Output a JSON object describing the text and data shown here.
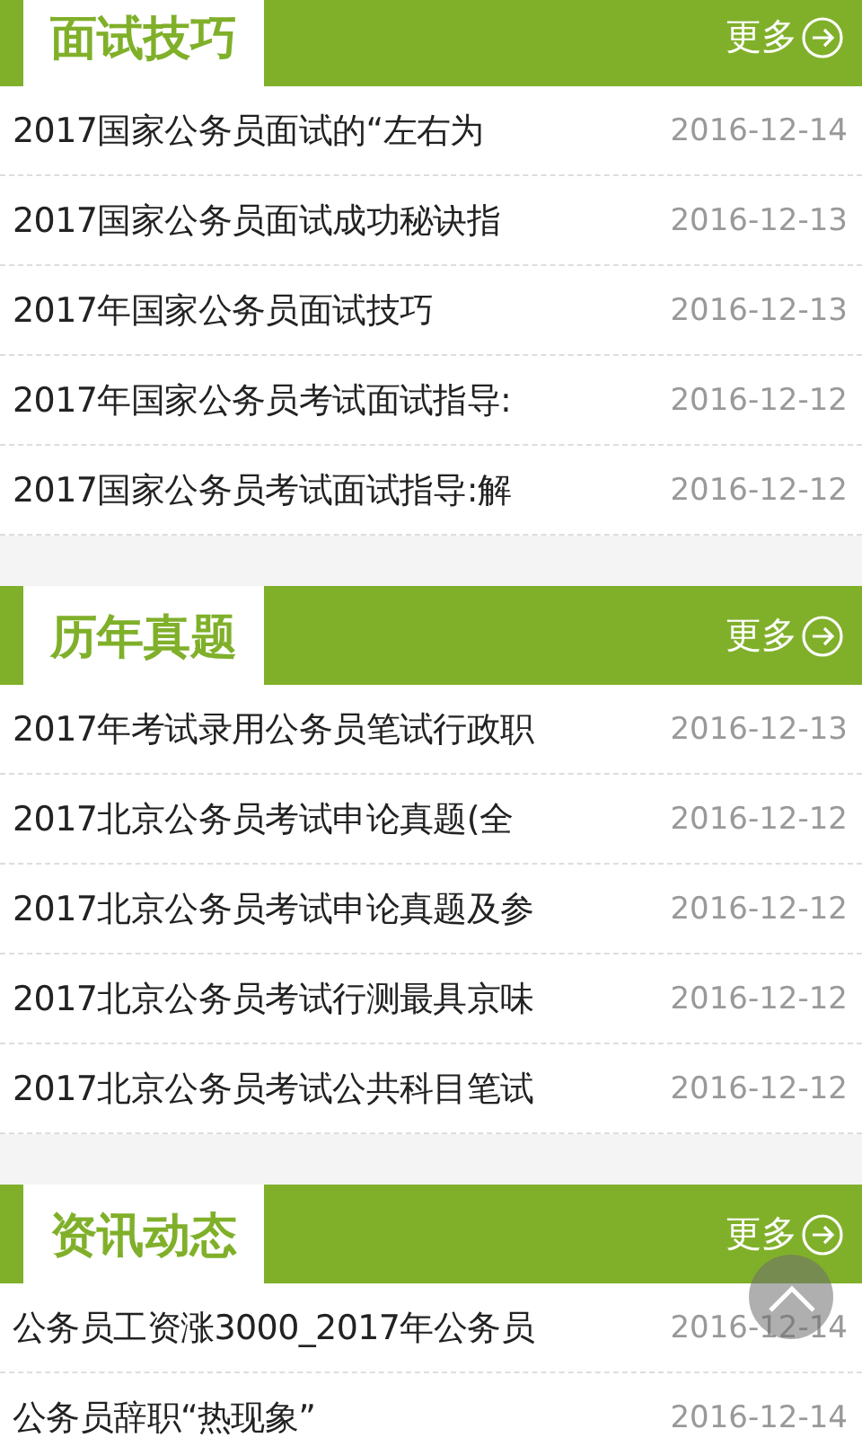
{
  "sections": [
    {
      "title": "面试技巧",
      "more": "更多",
      "items": [
        {
          "title": "2017国家公务员面试的“左右为",
          "date": "2016-12-14"
        },
        {
          "title": "2017国家公务员面试成功秘诀指",
          "date": "2016-12-13"
        },
        {
          "title": "2017年国家公务员面试技巧",
          "date": "2016-12-13"
        },
        {
          "title": "2017年国家公务员考试面试指导:",
          "date": "2016-12-12"
        },
        {
          "title": "2017国家公务员考试面试指导:解",
          "date": "2016-12-12"
        }
      ]
    },
    {
      "title": "历年真题",
      "more": "更多",
      "items": [
        {
          "title": "2017年考试录用公务员笔试行政职",
          "date": "2016-12-13"
        },
        {
          "title": "2017北京公务员考试申论真题(全",
          "date": "2016-12-12"
        },
        {
          "title": "2017北京公务员考试申论真题及参",
          "date": "2016-12-12"
        },
        {
          "title": "2017北京公务员考试行测最具京味",
          "date": "2016-12-12"
        },
        {
          "title": "2017北京公务员考试公共科目笔试",
          "date": "2016-12-12"
        }
      ]
    },
    {
      "title": "资讯动态",
      "more": "更多",
      "items": [
        {
          "title": "公务员工资涨3000_2017年公务员",
          "date": "2016-12-14"
        },
        {
          "title": "公务员辞职“热现象”",
          "date": "2016-12-14"
        }
      ]
    }
  ]
}
